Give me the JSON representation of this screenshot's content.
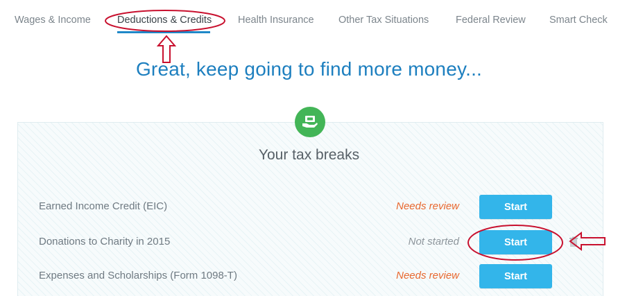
{
  "nav": {
    "tabs": [
      {
        "label": "Wages & Income"
      },
      {
        "label": "Deductions & Credits",
        "active": true
      },
      {
        "label": "Health Insurance"
      },
      {
        "label": "Other Tax Situations"
      },
      {
        "label": "Federal Review"
      },
      {
        "label": "Smart Check"
      }
    ]
  },
  "headline": "Great, keep going to find more money...",
  "card": {
    "icon": "money-hand-icon",
    "title": "Your tax breaks",
    "rows": [
      {
        "label": "Earned Income Credit (EIC)",
        "status": "Needs review",
        "button": "Start"
      },
      {
        "label": "Donations to Charity in 2015",
        "status": "Not started",
        "button": "Start"
      },
      {
        "label": "Expenses and Scholarships (Form 1098-T)",
        "status": "Needs review",
        "button": "Start"
      }
    ]
  },
  "colors": {
    "accent_blue": "#1d7fbf",
    "button_blue": "#33b5ea",
    "needs_review": "#e8682f",
    "not_started": "#8e969c",
    "icon_green": "#43b557",
    "annotation_red": "#c8102e"
  }
}
